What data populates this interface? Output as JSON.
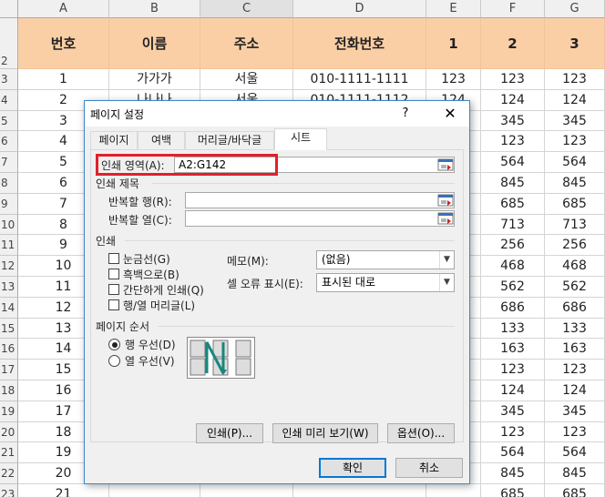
{
  "sheet": {
    "columns": [
      "A",
      "B",
      "C",
      "D",
      "E",
      "F",
      "G"
    ],
    "header_row": {
      "row": "2",
      "cells": [
        "번호",
        "이름",
        "주소",
        "전화번호",
        "1",
        "2",
        "3"
      ]
    },
    "rows": [
      {
        "row": "3",
        "cells": [
          "1",
          "가가가",
          "서울",
          "010-1111-1111",
          "123",
          "123",
          "123"
        ]
      },
      {
        "row": "4",
        "cells": [
          "2",
          "나나나",
          "서울",
          "010-1111-1112",
          "124",
          "124",
          "124"
        ]
      },
      {
        "row": "5",
        "cells": [
          "3",
          "",
          "",
          "",
          "",
          "345",
          "345"
        ]
      },
      {
        "row": "6",
        "cells": [
          "4",
          "",
          "",
          "",
          "",
          "123",
          "123"
        ]
      },
      {
        "row": "7",
        "cells": [
          "5",
          "",
          "",
          "",
          "",
          "564",
          "564"
        ]
      },
      {
        "row": "8",
        "cells": [
          "6",
          "",
          "",
          "",
          "",
          "845",
          "845"
        ]
      },
      {
        "row": "9",
        "cells": [
          "7",
          "",
          "",
          "",
          "",
          "685",
          "685"
        ]
      },
      {
        "row": "10",
        "cells": [
          "8",
          "",
          "",
          "",
          "",
          "713",
          "713"
        ]
      },
      {
        "row": "11",
        "cells": [
          "9",
          "",
          "",
          "",
          "",
          "256",
          "256"
        ]
      },
      {
        "row": "12",
        "cells": [
          "10",
          "",
          "",
          "",
          "",
          "468",
          "468"
        ]
      },
      {
        "row": "13",
        "cells": [
          "11",
          "",
          "",
          "",
          "",
          "562",
          "562"
        ]
      },
      {
        "row": "14",
        "cells": [
          "12",
          "",
          "",
          "",
          "",
          "686",
          "686"
        ]
      },
      {
        "row": "15",
        "cells": [
          "13",
          "",
          "",
          "",
          "",
          "133",
          "133"
        ]
      },
      {
        "row": "16",
        "cells": [
          "14",
          "",
          "",
          "",
          "",
          "163",
          "163"
        ]
      },
      {
        "row": "17",
        "cells": [
          "15",
          "",
          "",
          "",
          "",
          "123",
          "123"
        ]
      },
      {
        "row": "18",
        "cells": [
          "16",
          "",
          "",
          "",
          "",
          "124",
          "124"
        ]
      },
      {
        "row": "19",
        "cells": [
          "17",
          "",
          "",
          "",
          "",
          "345",
          "345"
        ]
      },
      {
        "row": "20",
        "cells": [
          "18",
          "",
          "",
          "",
          "",
          "123",
          "123"
        ]
      },
      {
        "row": "21",
        "cells": [
          "19",
          "",
          "",
          "",
          "",
          "564",
          "564"
        ]
      },
      {
        "row": "22",
        "cells": [
          "20",
          "",
          "",
          "",
          "",
          "845",
          "845"
        ]
      },
      {
        "row": "23",
        "cells": [
          "21",
          "",
          "",
          "",
          "",
          "685",
          "685"
        ]
      }
    ]
  },
  "dialog": {
    "title": "페이지 설정",
    "help": "?",
    "close": "✕",
    "tabs": [
      "페이지",
      "여백",
      "머리글/바닥글",
      "시트"
    ],
    "print_area_label": "인쇄 영역(A):",
    "print_area_value": "A2:G142",
    "print_titles_section": "인쇄 제목",
    "repeat_rows_label": "반복할 행(R):",
    "repeat_rows_value": "",
    "repeat_cols_label": "반복할 열(C):",
    "repeat_cols_value": "",
    "print_section": "인쇄",
    "gridlines_label": "눈금선(G)",
    "bw_label": "흑백으로(B)",
    "draft_label": "간단하게 인쇄(Q)",
    "headings_label": "행/열 머리글(L)",
    "comments_label": "메모(M):",
    "comments_value": "(없음)",
    "errors_label": "셀 오류 표시(E):",
    "errors_value": "표시된 대로",
    "page_order_section": "페이지 순서",
    "down_over_label": "행 우선(D)",
    "over_down_label": "열 우선(V)",
    "print_button": "인쇄(P)...",
    "preview_button": "인쇄 미리 보기(W)",
    "options_button": "옵션(O)...",
    "ok_button": "확인",
    "cancel_button": "취소",
    "accent_color": "#0078d7",
    "highlight_color": "#e0202b"
  }
}
